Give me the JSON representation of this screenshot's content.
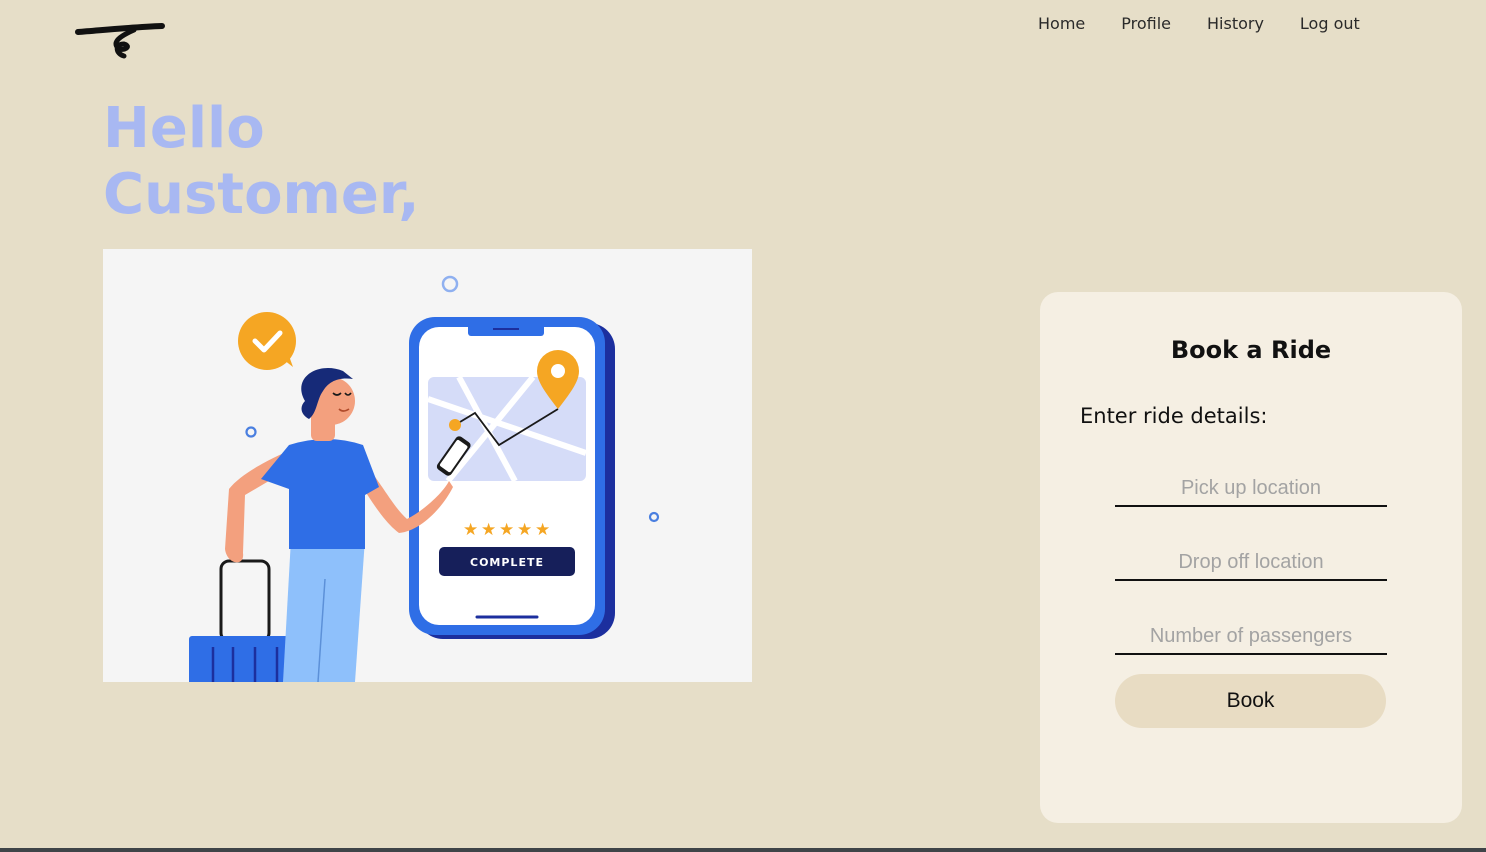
{
  "nav": {
    "items": [
      {
        "label": "Home"
      },
      {
        "label": "Profile"
      },
      {
        "label": "History"
      },
      {
        "label": "Log out"
      }
    ]
  },
  "greeting": {
    "line1": "Hello",
    "line2": "Customer,"
  },
  "hero": {
    "complete_label": "COMPLETE",
    "rating_stars": 5
  },
  "booking": {
    "title": "Book a Ride",
    "subtitle": "Enter ride details:",
    "pickup_placeholder": "Pick up location",
    "dropoff_placeholder": "Drop off location",
    "passengers_placeholder": "Number of passengers",
    "book_label": "Book"
  },
  "colors": {
    "background": "#e6dec8",
    "accent": "#a8b8f2",
    "card": "#f5efe3",
    "button": "#e8dcc3"
  }
}
